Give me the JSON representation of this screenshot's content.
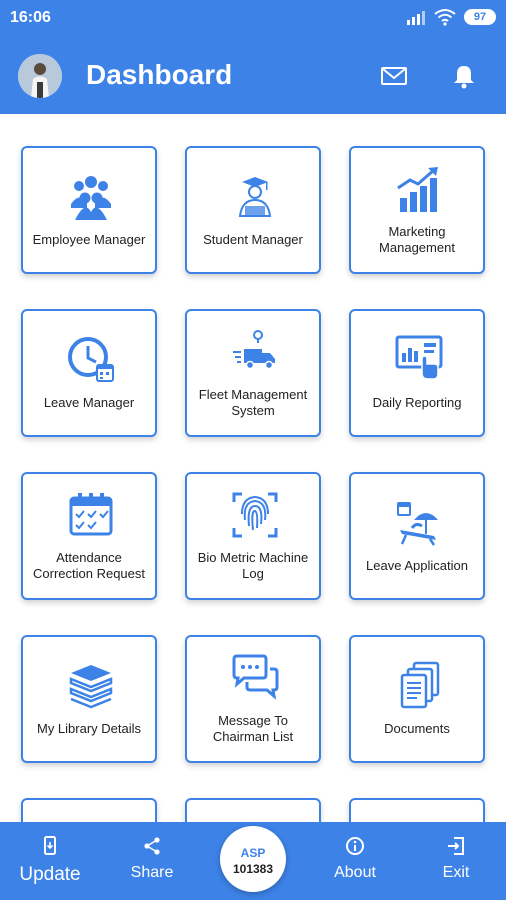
{
  "status_bar": {
    "time": "16:06",
    "battery": "97"
  },
  "app_bar": {
    "title": "Dashboard"
  },
  "tiles": [
    {
      "label": "Employee Manager",
      "icon": "team-icon"
    },
    {
      "label": "Student Manager",
      "icon": "graduate-icon"
    },
    {
      "label": "Marketing Management",
      "icon": "growth-chart-icon"
    },
    {
      "label": "Leave Manager",
      "icon": "clock-calendar-icon"
    },
    {
      "label": "Fleet Management System",
      "icon": "delivery-truck-icon"
    },
    {
      "label": "Daily Reporting",
      "icon": "report-screen-icon"
    },
    {
      "label": "Attendance Correction Request",
      "icon": "attendance-calendar-icon"
    },
    {
      "label": "Bio Metric Machine Log",
      "icon": "fingerprint-icon"
    },
    {
      "label": "Leave Application",
      "icon": "vacation-icon"
    },
    {
      "label": "My Library Details",
      "icon": "books-icon"
    },
    {
      "label": "Message To Chairman List",
      "icon": "chat-icon"
    },
    {
      "label": "Documents",
      "icon": "documents-icon"
    }
  ],
  "bottom_bar": {
    "update": "Update",
    "share": "Share",
    "badge_top": "ASP",
    "badge_bottom": "101383",
    "about": "About",
    "exit": "Exit"
  },
  "colors": {
    "primary": "#3d82e6",
    "tile_border": "#3d82e6",
    "icon": "#3d82e6"
  }
}
